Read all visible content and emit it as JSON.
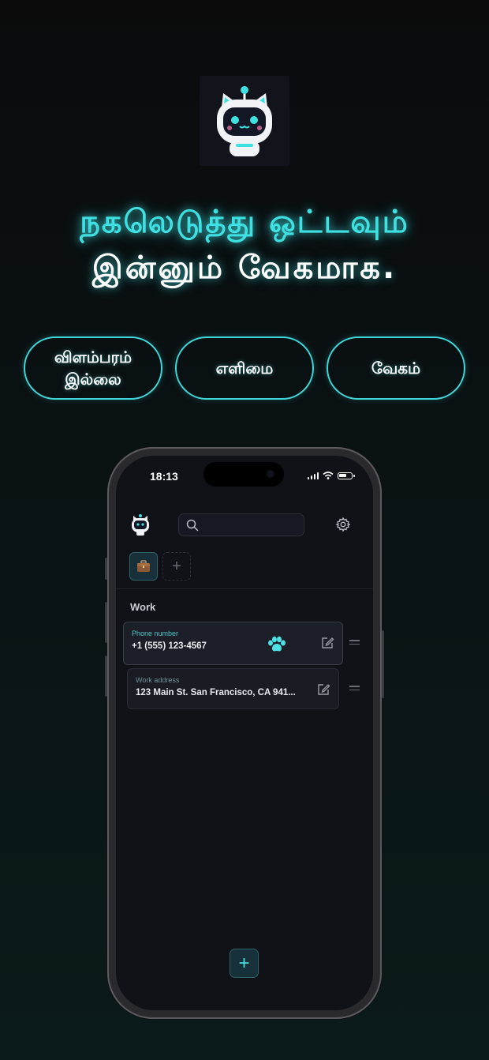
{
  "headline": {
    "line1": "நகலெடுத்து ஒட்டவும்",
    "line2": "இன்னும் வேகமாக."
  },
  "features": [
    {
      "label": "விளம்பரம்\nஇல்லை"
    },
    {
      "label": "எளிமை"
    },
    {
      "label": "வேகம்"
    }
  ],
  "phone": {
    "status": {
      "time": "18:13"
    },
    "app": {
      "search_placeholder": "",
      "tabs": [
        {
          "icon": "briefcase-icon",
          "active": true
        }
      ],
      "add_tab_label": "+",
      "group_title": "Work",
      "entries": [
        {
          "label": "Phone number",
          "value": "+1 (555) 123-4567"
        },
        {
          "label": "Work address",
          "value": "123 Main St. San Francisco, CA 941..."
        }
      ],
      "fab_label": "+"
    }
  },
  "colors": {
    "accent": "#3fe0e2",
    "background": "#0b1214",
    "card": "#1a1c24"
  }
}
